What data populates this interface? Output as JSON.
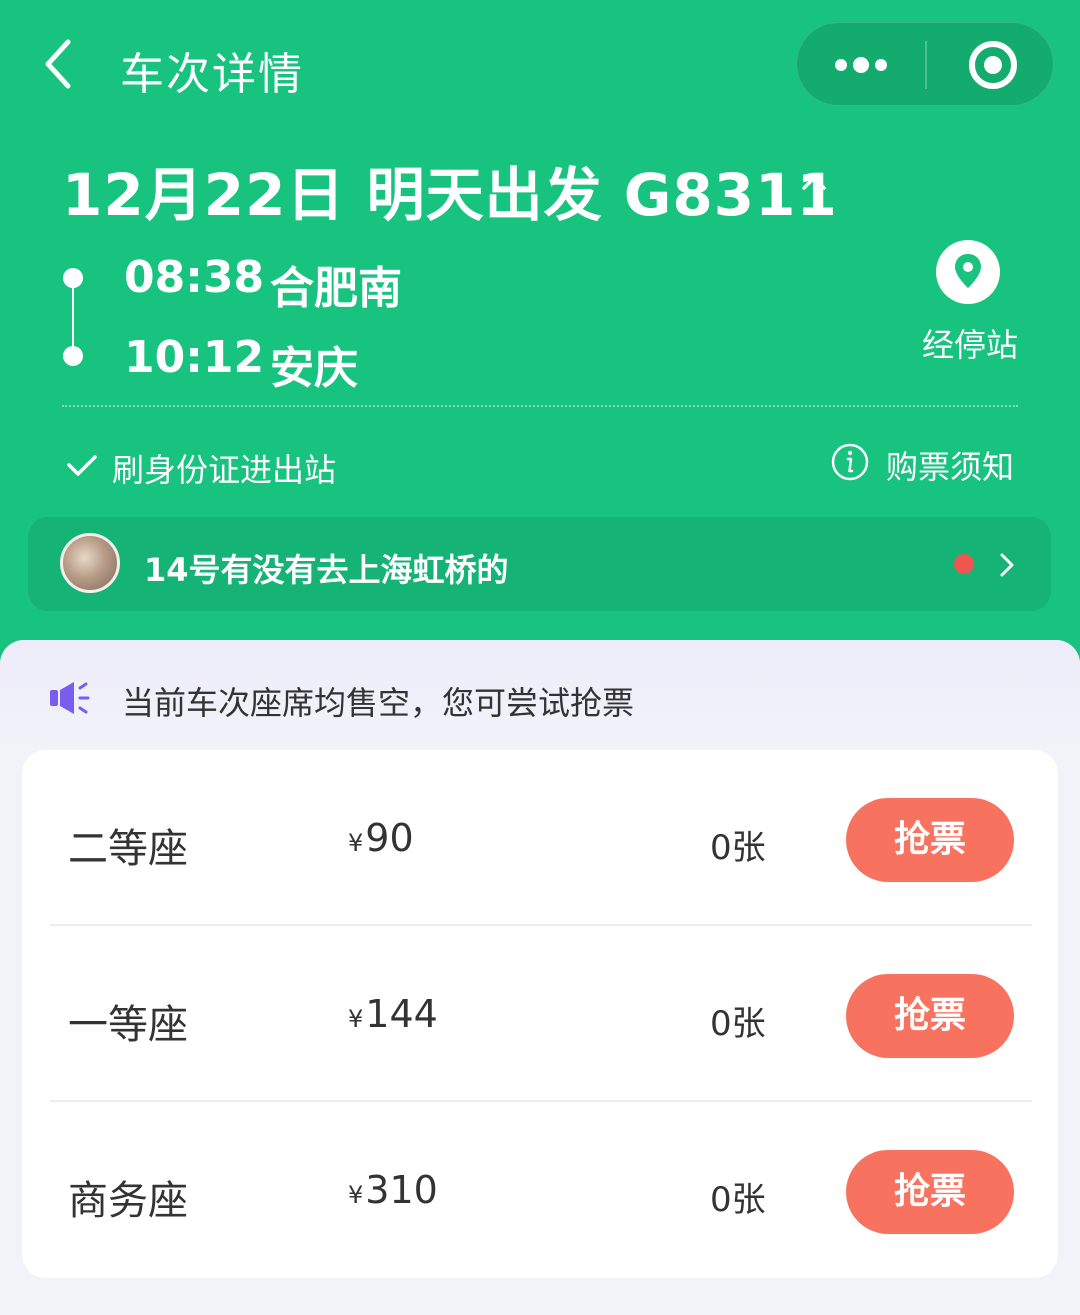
{
  "nav": {
    "title": "车次详情"
  },
  "trip": {
    "title": "12月22日 明天出发 G8311",
    "departure": {
      "time": "08:38",
      "station": "合肥南"
    },
    "arrival": {
      "time": "10:12",
      "station": "安庆"
    },
    "stops_label": "经停站"
  },
  "info": {
    "id_check": "刷身份证进出站",
    "purchase_notice": "购票须知"
  },
  "chat": {
    "message": "14号有没有去上海虹桥的"
  },
  "banner": {
    "text": "当前车次座席均售空，您可尝试抢票"
  },
  "seats": [
    {
      "name": "二等座",
      "currency": "¥",
      "price": "90",
      "count": "0张",
      "button": "抢票"
    },
    {
      "name": "一等座",
      "currency": "¥",
      "price": "144",
      "count": "0张",
      "button": "抢票"
    },
    {
      "name": "商务座",
      "currency": "¥",
      "price": "310",
      "count": "0张",
      "button": "抢票"
    }
  ],
  "colors": {
    "primary": "#17c37f",
    "button": "#f7735f",
    "badge": "#f0564f",
    "speaker": "#7b5cf0"
  },
  "icons": [
    "back-arrow-icon",
    "more-dots-icon",
    "close-circle-icon",
    "chevron-up-icon",
    "location-pin-icon",
    "checkmark-icon",
    "info-icon",
    "chevron-right-icon",
    "speaker-icon"
  ]
}
